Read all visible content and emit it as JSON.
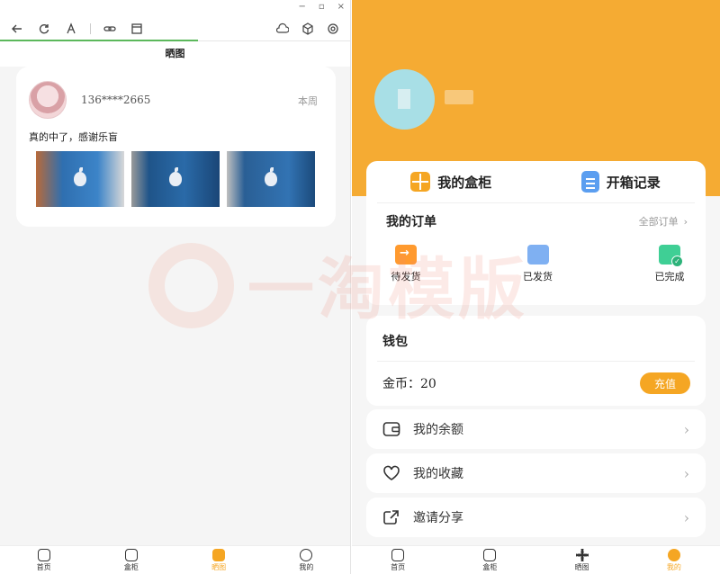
{
  "left": {
    "window_controls": [
      "−",
      "▫",
      "×"
    ],
    "page_title": "晒图",
    "post": {
      "user": "136****2665",
      "time": "本周",
      "text": "真的中了，感谢乐盲",
      "photos": [
        "iphone-photo-1",
        "iphone-photo-2",
        "iphone-photo-3"
      ]
    },
    "watermark": "一淘模版",
    "tabs": [
      {
        "label": "首页",
        "icon": "home-icon"
      },
      {
        "label": "盒柜",
        "icon": "cabinet-icon"
      },
      {
        "label": "晒图",
        "icon": "gallery-icon",
        "active": true
      },
      {
        "label": "我的",
        "icon": "profile-icon"
      }
    ]
  },
  "right": {
    "quick": {
      "box_label": "我的盒柜",
      "record_label": "开箱记录"
    },
    "orders": {
      "title": "我的订单",
      "all_label": "全部订单",
      "items": [
        "待发货",
        "已发货",
        "已完成"
      ]
    },
    "wallet": {
      "title": "钱包",
      "coins_label": "金币：20",
      "recharge_label": "充值"
    },
    "menu": [
      {
        "label": "我的余额",
        "icon": "wallet-icon"
      },
      {
        "label": "我的收藏",
        "icon": "heart-icon"
      },
      {
        "label": "邀请分享",
        "icon": "share-icon"
      }
    ],
    "tabs": [
      {
        "label": "首页",
        "icon": "home-icon"
      },
      {
        "label": "盒柜",
        "icon": "cabinet-icon"
      },
      {
        "label": "晒图",
        "icon": "gallery-icon"
      },
      {
        "label": "我的",
        "icon": "profile-icon",
        "active": true
      }
    ]
  },
  "colors": {
    "accent": "#f5a623",
    "header_orange": "#f5ab33",
    "progress_green": "#5cb85c"
  }
}
